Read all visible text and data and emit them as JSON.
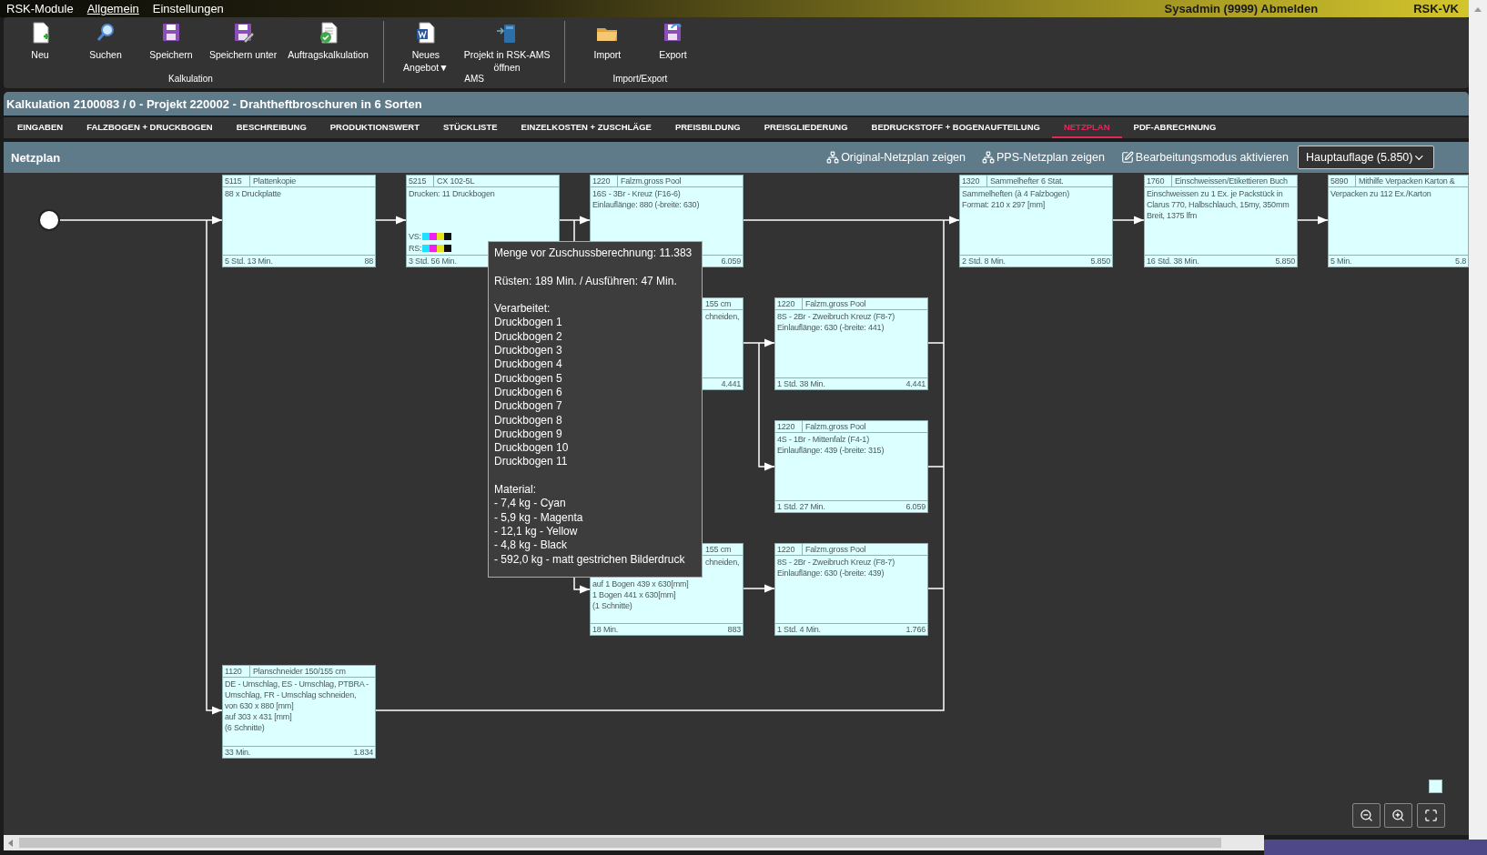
{
  "menu_bar": {
    "items": [
      {
        "label": "RSK-Module",
        "selected": false
      },
      {
        "label": "Allgemein",
        "selected": true
      },
      {
        "label": "Einstellungen",
        "selected": false
      }
    ],
    "user": "Sysadmin (9999) Abmelden",
    "app": "RSK-VK"
  },
  "ribbon": {
    "groups": [
      {
        "label": "Kalkulation",
        "buttons": [
          {
            "kind": "new",
            "lines": [
              "Neu"
            ]
          },
          {
            "kind": "search",
            "lines": [
              "Suchen"
            ]
          },
          {
            "kind": "save",
            "lines": [
              "Speichern"
            ]
          },
          {
            "kind": "save_as",
            "lines": [
              "Speichern unter"
            ]
          },
          {
            "kind": "calc",
            "lines": [
              "Auftragskalkulation"
            ]
          }
        ]
      },
      {
        "label": "AMS",
        "buttons": [
          {
            "kind": "offer",
            "lines": [
              "Neues",
              "Angebot▼"
            ]
          },
          {
            "kind": "ams",
            "lines": [
              "Projekt in RSK-AMS",
              "öffnen"
            ]
          }
        ]
      },
      {
        "label": "Import/Export",
        "buttons": [
          {
            "kind": "import",
            "lines": [
              "Import"
            ]
          },
          {
            "kind": "export",
            "lines": [
              "Export"
            ]
          }
        ]
      }
    ]
  },
  "title": "Kalkulation 2100083 / 0 - Projekt 220002 - Drahtheftbroschuren in 6 Sorten",
  "tabs": [
    {
      "label": "EINGABEN",
      "selected": false
    },
    {
      "label": "FALZBOGEN + DRUCKBOGEN",
      "selected": false
    },
    {
      "label": "BESCHREIBUNG",
      "selected": false
    },
    {
      "label": "PRODUKTIONSWERT",
      "selected": false
    },
    {
      "label": "STÜCKLISTE",
      "selected": false
    },
    {
      "label": "EINZELKOSTEN + ZUSCHLÄGE",
      "selected": false
    },
    {
      "label": "PREISBILDUNG",
      "selected": false
    },
    {
      "label": "PREISGLIEDERUNG",
      "selected": false
    },
    {
      "label": "BEDRUCKSTOFF + BOGENAUFTEILUNG",
      "selected": false
    },
    {
      "label": "NETZPLAN",
      "selected": true
    },
    {
      "label": "PDF-ABRECHNUNG",
      "selected": false
    }
  ],
  "header": {
    "title": "Netzplan",
    "actions": [
      {
        "kind": "network",
        "label": "Original-Netzplan zeigen"
      },
      {
        "kind": "network",
        "label": "PPS-Netzplan zeigen"
      },
      {
        "kind": "edit",
        "label": "Bearbeitungsmodus aktivieren"
      }
    ],
    "dropdown": "Hauptauflage (5.850)"
  },
  "canvas": {
    "nodes": [
      {
        "kind": "box",
        "code": "5115",
        "name": "Plattenkopie",
        "lines": [
          "88 x Druckplatte"
        ],
        "time": "5 Std. 13 Min.",
        "quantity": "88"
      },
      {
        "kind": "box",
        "code": "5215",
        "name": "CX 102-5L",
        "lines": [
          "Drucken: 11 Druckbogen"
        ],
        "inks": [
          {
            "label": "VS:",
            "swatches": [
              {
                "color": "#1ee0ff"
              },
              {
                "color": "#ee22ee"
              },
              {
                "color": "#e5e51e"
              },
              {
                "color": "#101010"
              }
            ]
          },
          {
            "label": "RS:",
            "swatches": [
              {
                "color": "#1ee0ff"
              },
              {
                "color": "#ee22ee"
              },
              {
                "color": "#e5e51e"
              },
              {
                "color": "#101010"
              }
            ]
          }
        ],
        "time": "3 Std. 56 Min."
      },
      {
        "kind": "box",
        "code": "1220",
        "name": "Falzm.gross Pool",
        "lines": [
          "16S - 3Br - Kreuz (F16-6)",
          "Einlauflänge: 880 (-breite: 630)"
        ],
        "quantity": "6.059"
      },
      {
        "kind": "box",
        "code": "1320",
        "name": "Sammelhefter 6 Stat.",
        "lines": [
          "Sammelheften (à 4 Falzbogen)",
          "Format: 210 x 297 [mm]"
        ],
        "time": "2 Std. 8 Min.",
        "quantity": "5.850"
      },
      {
        "kind": "box",
        "code": "1760",
        "name": "Einschweissen/Etikettieren Buch",
        "lines": [
          "Einschweissen zu 1 Ex. je Packstück in Clarus 770, Halbschlauch, 15my, 350mm Breit, 1375 lfm"
        ],
        "time": "16 Std. 38 Min.",
        "quantity": "5.850"
      },
      {
        "kind": "box",
        "code": "5890",
        "name": "Mithilfe Verpacken Karton &",
        "lines": [
          "Verpacken zu 112 Ex./Karton"
        ],
        "time": "5 Min.",
        "quantity": "5.8"
      },
      {
        "kind": "partly_hidden",
        "name": "155 cm",
        "tail_lines": [
          "chneiden,"
        ],
        "quantity": "4.441"
      },
      {
        "kind": "box",
        "code": "1220",
        "name": "Falzm.gross Pool",
        "lines": [
          "8S - 2Br - Zweibruch Kreuz (F8-7)",
          "Einlauflänge: 630 (-breite: 441)"
        ],
        "time": "1 Std. 38 Min.",
        "quantity": "4.441"
      },
      {
        "kind": "box",
        "code": "1220",
        "name": "Falzm.gross Pool",
        "lines": [
          "4S - 1Br - Mittenfalz (F4-1)",
          "Einlauflänge: 439 (-breite: 315)"
        ],
        "time": "1 Std. 27 Min.",
        "quantity": "6.059"
      },
      {
        "kind": "partly_hidden",
        "name": "155 cm",
        "tail_lines": [
          "chneiden,"
        ],
        "lines": [
          "auf 1 Bogen 439 x 630[mm]",
          "1 Bogen 441 x 630[mm]",
          "(1 Schnitte)"
        ],
        "time": "18 Min.",
        "quantity": "883"
      },
      {
        "kind": "box",
        "code": "1220",
        "name": "Falzm.gross Pool",
        "lines": [
          "8S - 2Br - Zweibruch Kreuz (F8-7)",
          "Einlauflänge: 630 (-breite: 439)"
        ],
        "time": "1 Std. 4 Min.",
        "quantity": "1.766"
      },
      {
        "kind": "box",
        "code": "1120",
        "name": "Planschneider 150/155 cm",
        "lines": [
          "DE - Umschlag, ES - Umschlag, PTBRA - Umschlag, FR - Umschlag schneiden,",
          "von 630 x 880 [mm]",
          "auf 303 x 431 [mm]",
          "(6 Schnitte)"
        ],
        "time": "33 Min.",
        "quantity": "1.834"
      }
    ],
    "tooltip": {
      "title": "Menge vor Zuschussberechnung: 11.383",
      "setup": "Rüsten: 189 Min. / Ausführen: 47 Min.",
      "processed_label": "Verarbeitet:",
      "processed": [
        "Druckbogen 1",
        "Druckbogen 2",
        "Druckbogen 3",
        "Druckbogen 4",
        "Druckbogen 5",
        "Druckbogen 6",
        "Druckbogen 7",
        "Druckbogen 8",
        "Druckbogen 9",
        "Druckbogen 10",
        "Druckbogen 11"
      ],
      "material_label": "Material:",
      "materials": [
        "- 7,4 kg - Cyan",
        "- 5,9 kg - Magenta",
        "- 12,1 kg - Yellow",
        "- 4,8 kg - Black",
        "- 592,0 kg - matt gestrichen Bilderdruck"
      ]
    }
  }
}
